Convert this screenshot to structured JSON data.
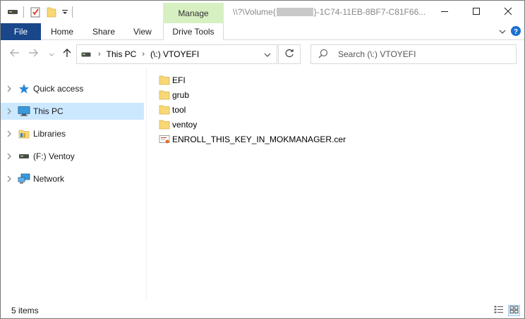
{
  "window": {
    "title_prefix": "\\\\?\\Volume{",
    "title_suffix": "}-1C74-11EB-8BF7-C81F66..."
  },
  "ribbon": {
    "contextual_group_label": "Manage",
    "tabs": [
      {
        "label": "File"
      },
      {
        "label": "Home"
      },
      {
        "label": "Share"
      },
      {
        "label": "View"
      },
      {
        "label": "Drive Tools"
      }
    ]
  },
  "address_bar": {
    "crumbs": [
      "This PC",
      "(\\:) VTOYEFI"
    ]
  },
  "search": {
    "placeholder": "Search (\\:) VTOYEFI"
  },
  "nav_pane": {
    "items": [
      {
        "label": "Quick access",
        "icon": "star-icon",
        "selected": false
      },
      {
        "label": "This PC",
        "icon": "computer-icon",
        "selected": true
      },
      {
        "label": "Libraries",
        "icon": "libraries-icon",
        "selected": false
      },
      {
        "label": "(F:) Ventoy",
        "icon": "drive-icon",
        "selected": false
      },
      {
        "label": "Network",
        "icon": "network-icon",
        "selected": false
      }
    ]
  },
  "files": [
    {
      "name": "EFI",
      "type": "folder"
    },
    {
      "name": "grub",
      "type": "folder"
    },
    {
      "name": "tool",
      "type": "folder"
    },
    {
      "name": "ventoy",
      "type": "folder"
    },
    {
      "name": "ENROLL_THIS_KEY_IN_MOKMANAGER.cer",
      "type": "certificate"
    }
  ],
  "status": {
    "item_count": "5 items"
  },
  "colors": {
    "file_tab": "#19478a",
    "manage_tab": "#d6f0c2",
    "selection": "#cce8ff",
    "folder": "#f8d775"
  }
}
